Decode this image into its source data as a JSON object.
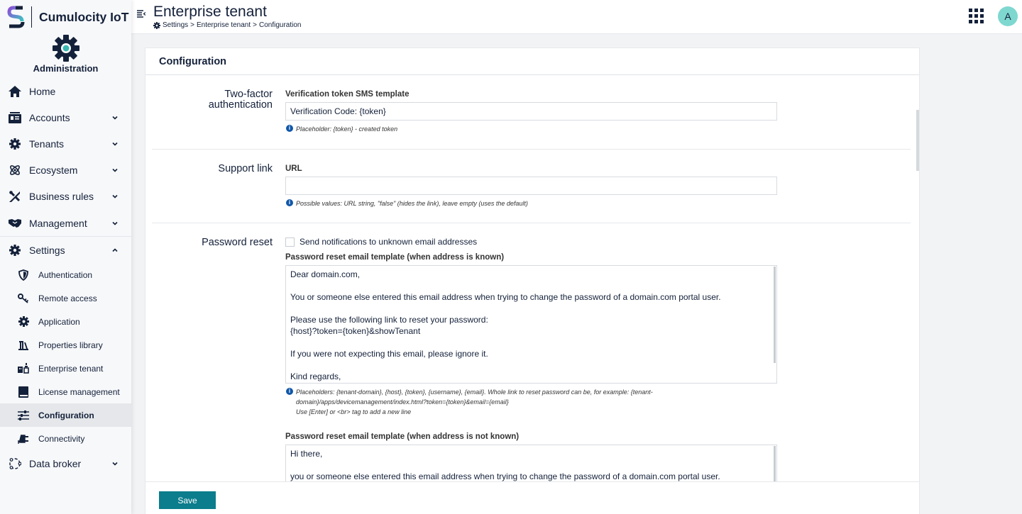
{
  "brand": {
    "name": "Cumulocity IoT",
    "app_name": "Administration",
    "logo_icon": "cumulocity-logo-icon",
    "app_icon": "gear-icon"
  },
  "sidebar": {
    "items": [
      {
        "label": "Home",
        "icon": "home-icon",
        "expandable": false
      },
      {
        "label": "Accounts",
        "icon": "accounts-icon",
        "expandable": true
      },
      {
        "label": "Tenants",
        "icon": "gear-icon",
        "expandable": true
      },
      {
        "label": "Ecosystem",
        "icon": "atom-icon",
        "expandable": true
      },
      {
        "label": "Business rules",
        "icon": "tools-icon",
        "expandable": true
      },
      {
        "label": "Management",
        "icon": "handshake-icon",
        "expandable": true
      }
    ],
    "settings": {
      "label": "Settings",
      "icon": "gear-icon",
      "expanded": true,
      "children": [
        {
          "label": "Authentication",
          "icon": "shield-icon"
        },
        {
          "label": "Remote access",
          "icon": "key-icon"
        },
        {
          "label": "Application",
          "icon": "gear-icon"
        },
        {
          "label": "Properties library",
          "icon": "library-icon"
        },
        {
          "label": "Enterprise tenant",
          "icon": "enterprise-icon"
        },
        {
          "label": "License management",
          "icon": "book-icon"
        },
        {
          "label": "Configuration",
          "icon": "sliders-icon",
          "active": true
        },
        {
          "label": "Connectivity",
          "icon": "plug-icon"
        }
      ]
    },
    "data_broker": {
      "label": "Data broker",
      "icon": "data-broker-icon",
      "expandable": true
    }
  },
  "header": {
    "title": "Enterprise tenant",
    "breadcrumb": [
      "Settings",
      "Enterprise tenant",
      "Configuration"
    ],
    "breadcrumb_separator": ">",
    "avatar_initial": "A"
  },
  "card": {
    "title": "Configuration",
    "save_label": "Save"
  },
  "two_factor": {
    "section_label_line1": "Two-factor",
    "section_label_line2": "authentication",
    "field_label": "Verification token SMS template",
    "value": "Verification Code: {token}",
    "hint": "Placeholder: {token} - created token"
  },
  "support_link": {
    "section_label": "Support link",
    "field_label": "URL",
    "value": "",
    "hint": "Possible values: URL string, \"false\" (hides the link), leave empty (uses the default)"
  },
  "password_reset": {
    "section_label": "Password reset",
    "checkbox_label": "Send notifications to unknown email addresses",
    "checkbox_checked": false,
    "known_label": "Password reset email template (when address is known)",
    "known_lines": [
      "Dear domain.com,",
      "",
      "You or someone else entered this email address when trying to change the password of a domain.com portal user.",
      "",
      "Please use the following link to reset your password:",
      "{host}?token={token}&showTenant",
      "",
      "If you were not expecting this email, please ignore it.",
      "",
      "Kind regards,"
    ],
    "known_hint_line1": "Placeholders: {tenant-domain}, {host}, {token}, {username}, {email}. Whole link to reset password can be, for example: {tenant-",
    "known_hint_line2": "domain}/apps/devicemanagement/index.html?token={token}&email={email}",
    "known_hint_line3": "Use [Enter] or <br> tag to add a new line",
    "unknown_label": "Password reset email template (when address is not known)",
    "unknown_lines": [
      "Hi there,",
      "",
      "you or someone else entered this email address when trying to change the password of a domain.com portal user."
    ]
  }
}
